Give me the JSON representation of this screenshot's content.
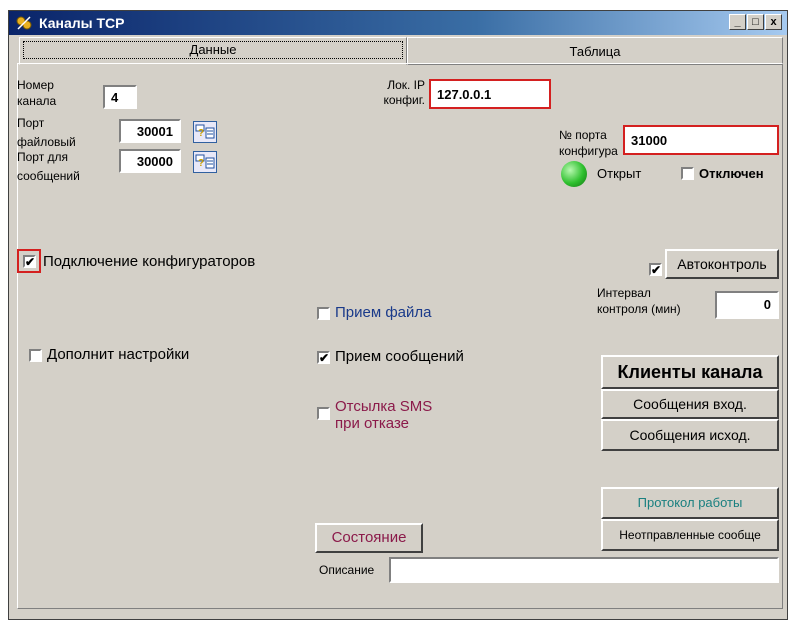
{
  "window": {
    "title": "Каналы TCP",
    "buttons": {
      "minimize": "_",
      "maximize": "□",
      "close": "x"
    }
  },
  "tabs": [
    {
      "label": "Данные",
      "active": true
    },
    {
      "label": "Таблица",
      "active": false
    }
  ],
  "channel": {
    "label_line1": "Номер",
    "label_line2": "канала",
    "value": "4"
  },
  "file_port": {
    "label_line1": "Порт",
    "label_line2": "файловый",
    "value": "30001"
  },
  "msg_port": {
    "label_line1": "Порт для",
    "label_line2": "сообщений",
    "value": "30000"
  },
  "ip": {
    "label_line1": "Лок. IP",
    "label_line2": "конфиг.",
    "value": "127.0.0.1"
  },
  "config_port": {
    "label_line1": "№ порта",
    "label_line2": "конфигура",
    "value": "31000"
  },
  "status": {
    "open_label": "Открыт",
    "disabled_label": "Отключен",
    "disabled_checked": false,
    "indicator_color": "#2ec02e"
  },
  "connect_configurators": {
    "label": "Подключение конфигураторов",
    "checked": true
  },
  "extra_settings": {
    "label": "Дополнит настройки",
    "checked": false
  },
  "receive_file": {
    "label": "Прием файла",
    "checked": false
  },
  "receive_messages": {
    "label": "Прием сообщений",
    "checked": true
  },
  "sms_on_fail": {
    "label_line1": "Отсылка SMS",
    "label_line2": "при отказе",
    "checked": false
  },
  "autocontrol": {
    "label": "Автоконтроль",
    "checked": true
  },
  "interval": {
    "label_line1": "Интервал",
    "label_line2": "контроля (мин)",
    "value": "0"
  },
  "buttons": {
    "channel_clients": "Клиенты канала",
    "incoming_messages": "Сообщения вход.",
    "outgoing_messages": "Сообщения исход.",
    "work_log": "Протокол работы",
    "unsent_messages": "Неотправленные сообще",
    "state": "Состояние"
  },
  "description": {
    "label": "Описание",
    "value": ""
  },
  "colors": {
    "title_bar": "#0a246a",
    "highlight_red": "#d42020",
    "link_blue": "#1a3a8a",
    "maroon": "#8b1a4a",
    "teal": "#1a8080"
  }
}
